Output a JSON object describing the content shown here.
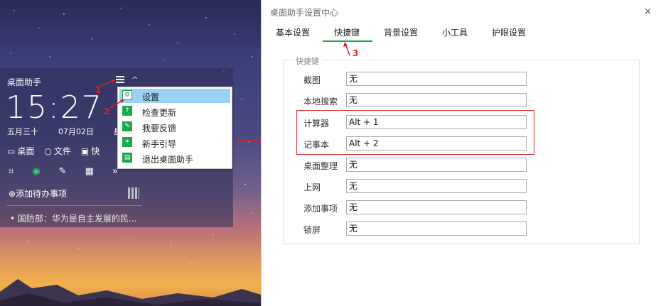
{
  "widget": {
    "title": "桌面助手",
    "clock": "15:27",
    "lunar": "五月三十",
    "date": "07月02日",
    "weekday": "星",
    "tools": [
      "桌面",
      "文件",
      "快"
    ],
    "add_todo": "添加待办事项",
    "news": "国防部：华为是自主发展的民..."
  },
  "context_menu": {
    "items": [
      "设置",
      "检查更新",
      "我要反馈",
      "新手引导",
      "退出桌面助手"
    ],
    "icons": [
      "gear-icon",
      "upload-icon",
      "edit-icon",
      "leaf-icon",
      "exit-icon"
    ]
  },
  "annotations": [
    "1",
    "2",
    "3"
  ],
  "settings": {
    "window_title": "桌面助手设置中心",
    "close_glyph": "×",
    "tabs": [
      "基本设置",
      "快捷键",
      "背景设置",
      "小工具",
      "护眼设置"
    ],
    "active_tab": "快捷键",
    "group_title": "快捷键",
    "rows": [
      {
        "label": "截图",
        "value": "无"
      },
      {
        "label": "本地搜索",
        "value": "无"
      },
      {
        "label": "计算器",
        "value": "Alt + 1"
      },
      {
        "label": "记事本",
        "value": "Alt + 2"
      },
      {
        "label": "桌面整理",
        "value": "无"
      },
      {
        "label": "上网",
        "value": "无"
      },
      {
        "label": "添加事项",
        "value": "无"
      },
      {
        "label": "锁屏",
        "value": "无"
      }
    ]
  },
  "colors": {
    "accent_green": "#1ea84e",
    "highlight_red": "#d03030",
    "menu_selected": "#9bd1f5"
  }
}
